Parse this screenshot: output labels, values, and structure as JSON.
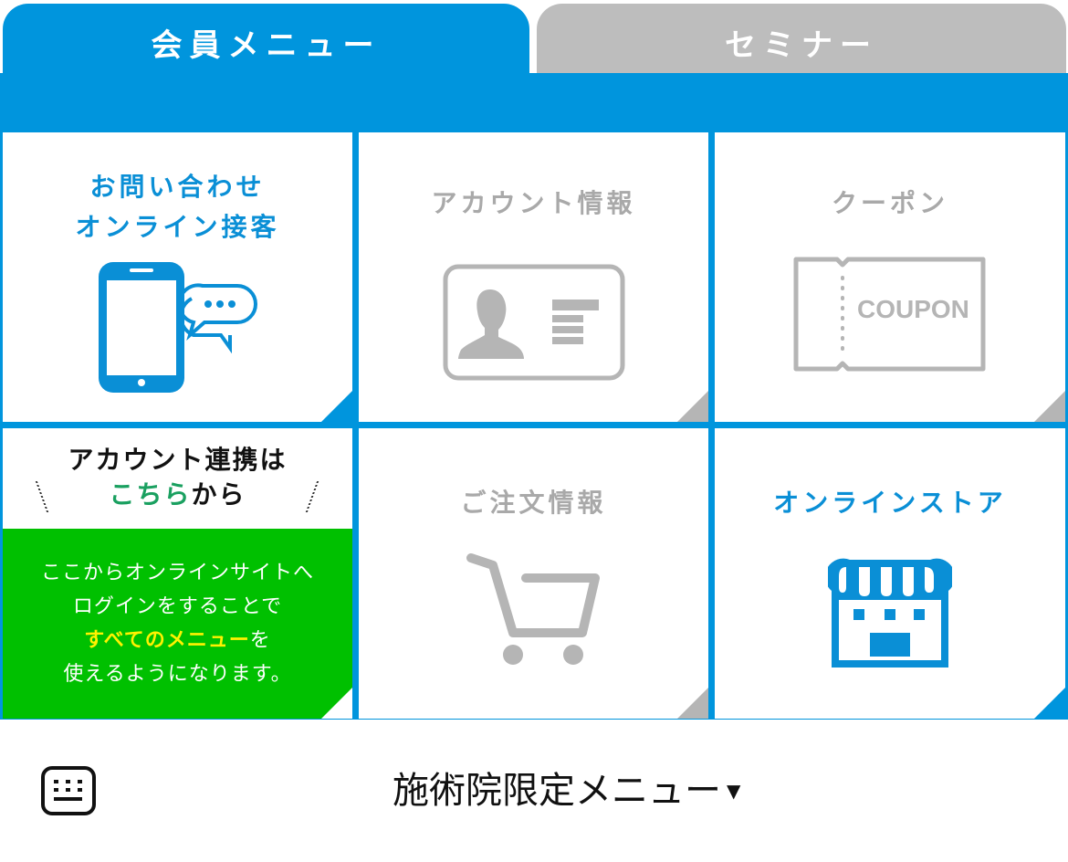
{
  "tabs": [
    {
      "label": "会員メニュー",
      "active": true
    },
    {
      "label": "セミナー",
      "active": false
    }
  ],
  "tiles": {
    "inquiry": {
      "line1": "お問い合わせ",
      "line2": "オンライン接客",
      "icon": "smartphone-chat-icon"
    },
    "account_info": {
      "label": "アカウント情報",
      "icon": "id-card-icon"
    },
    "coupon": {
      "label": "クーポン",
      "icon": "coupon-ticket-icon",
      "icon_text": "COUPON"
    },
    "account_link": {
      "title_line1": "アカウント連携は",
      "title_highlight": "こちら",
      "title_rest": "から",
      "desc_line1": "ここからオンラインサイトへ",
      "desc_line2": "ログインをすることで",
      "desc_highlight": "すべてのメニュー",
      "desc_line3_rest": "を",
      "desc_line4": "使えるようになります。"
    },
    "order_info": {
      "label": "ご注文情報",
      "icon": "shopping-cart-icon"
    },
    "online_store": {
      "label": "オンラインストア",
      "icon": "storefront-icon"
    }
  },
  "bottom_bar": {
    "keyboard_icon": "keyboard-icon",
    "menu_title": "施術院限定メニュー",
    "dropdown_arrow": "▼"
  },
  "colors": {
    "brand_blue": "#0095dd",
    "inactive_gray": "#bdbdbd",
    "green": "#00c000",
    "yellow": "#fff200"
  }
}
